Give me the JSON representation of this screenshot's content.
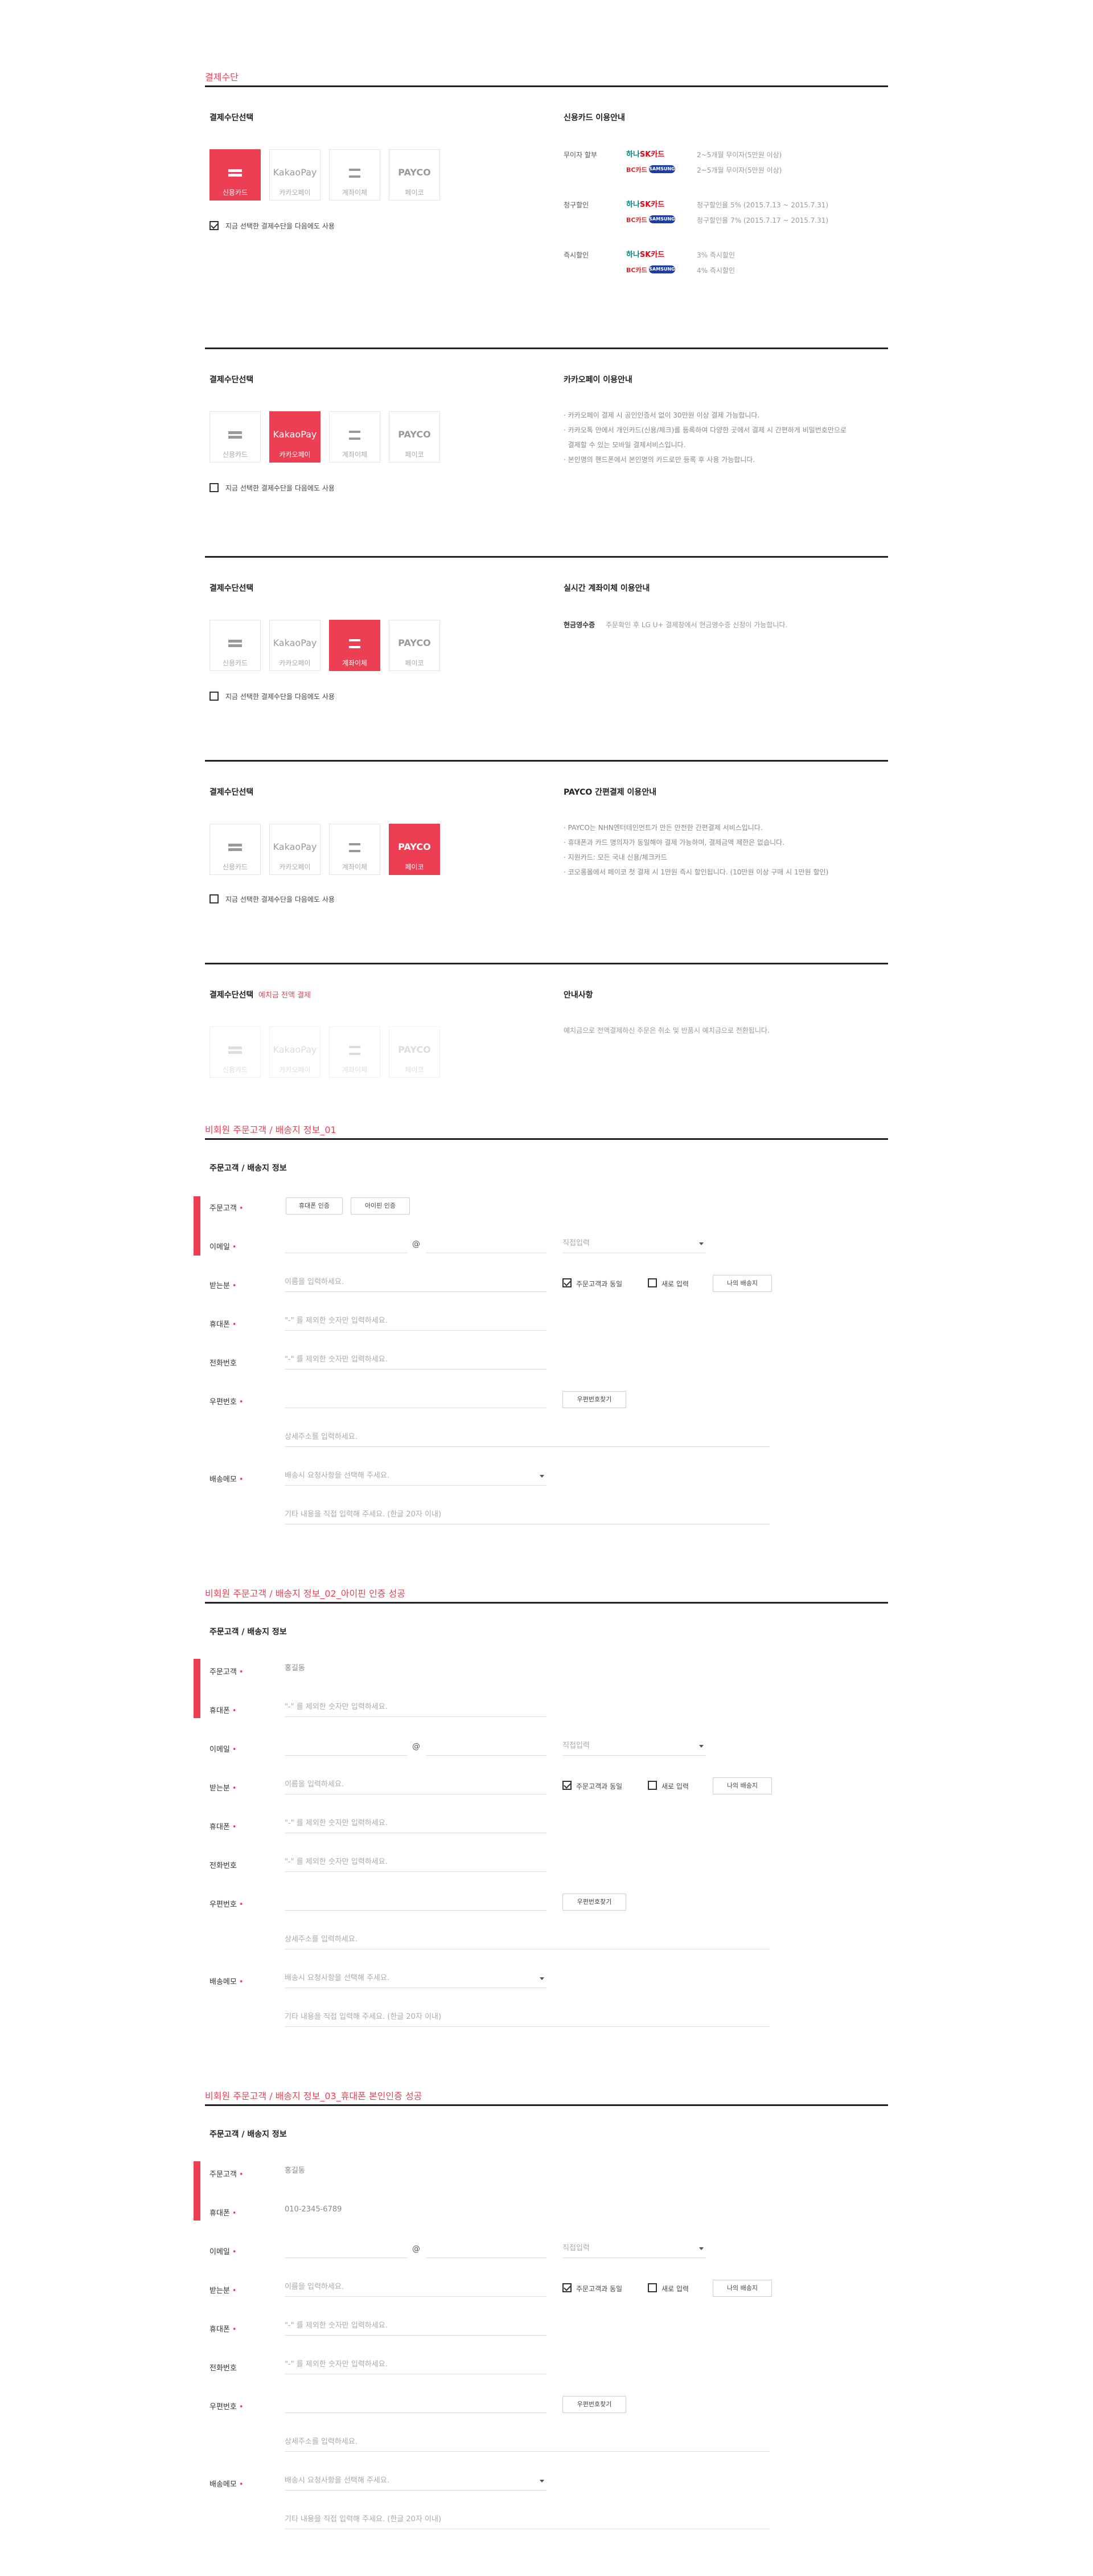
{
  "colors": {
    "accent": "#ec3f53",
    "text": "#333333"
  },
  "section1": {
    "title": "결제수단",
    "pay_title": "결제수단선택",
    "methods": [
      {
        "icon": "card-icon",
        "brand": "",
        "label": "신용카드"
      },
      {
        "icon": "kakaopay-icon",
        "brand": "KakaoPay",
        "label": "카카오페이"
      },
      {
        "icon": "bank-icon",
        "brand": "",
        "label": "계좌이체"
      },
      {
        "icon": "payco-icon",
        "brand": "PAYCO",
        "label": "페이코"
      }
    ],
    "remember": "지금 선택한 결제수단을 다음에도 사용",
    "info_title": "신용카드 이용안내",
    "rows": [
      {
        "label": "무이자 할부",
        "lines": [
          "2~5개월 무이자(5만원 이상)",
          "2~5개월 무이자(5만원 이상)"
        ]
      },
      {
        "label": "청구할인",
        "lines": [
          "청구할인율 5% (2015.7.13 ~ 2015.7.31)",
          "청구할인율 7% (2015.7.17 ~ 2015.7.31)"
        ]
      },
      {
        "label": "즉시할인",
        "lines": [
          "3% 즉시할인",
          "4% 즉시할인"
        ]
      }
    ],
    "logos": {
      "hana_a": "하나",
      "hana_b": "SK카드",
      "bc": "BC카드",
      "samsung": "SAMSUNG"
    }
  },
  "section2": {
    "pay_title": "결제수단선택",
    "info_title": "카카오페이 이용안내",
    "bullets": [
      "· 카카오페이 결제 시 공인인증서 없이 30만원 이상 결제 가능합니다.",
      "· 카카오톡 안에서 개인카드(신용/체크)를 등록하여 다양한 곳에서 결제 시 간편하게 비밀번호만으로",
      "  결제할 수 있는 모바일 결제서비스입니다.",
      "· 본인명의 핸드폰에서 본인명의 카드로만 등록 후 사용 가능합니다."
    ],
    "remember": "지금 선택한 결제수단을 다음에도 사용"
  },
  "section3": {
    "pay_title": "결제수단선택",
    "info_title": "실시간 계좌이체 이용안내",
    "receipt_label": "현금영수증",
    "receipt_text": "주문확인 후 LG U+ 결제창에서 현금영수증 신청이 가능합니다.",
    "remember": "지금 선택한 결제수단을 다음에도 사용"
  },
  "section4": {
    "pay_title": "결제수단선택",
    "info_title": "PAYCO 간편결제 이용안내",
    "bullets": [
      "· PAYCO는 NHN엔터테인먼트가 만든 안전한 간편결제 서비스입니다.",
      "· 휴대폰과 카드 명의자가 동일해야 결제 가능하며, 결제금액 제한은 없습니다.",
      "· 지원카드: 모든 국내 신용/체크카드",
      "· 코오롱몰에서 페이코 첫 결제 시 1만원 즉시 할인됩니다. (10만원 이상 구매 시 1만원 할인)"
    ],
    "remember": "지금 선택한 결제수단을 다음에도 사용"
  },
  "section5": {
    "pay_title": "결제수단선택",
    "pay_note": "예치금 전액 결제",
    "info_title": "안내사항",
    "info_text": "예치금으로 전액결제하신 주문은 취소 및 반품시 예치금으로 전환됩니다."
  },
  "forms": [
    {
      "title": "비회원 주문고객 / 배송지 정보_01"
    },
    {
      "title": "비회원 주문고객 / 배송지 정보_02_아이핀 인증 성공"
    },
    {
      "title": "비회원 주문고객 / 배송지 정보_03_휴대폰 본인인증 성공"
    }
  ],
  "form": {
    "sub_title": "주문고객 / 배송지 정보",
    "labels": {
      "orderer": "주문고객",
      "email": "이메일",
      "receiver": "받는분",
      "mobile": "휴대폰",
      "phone": "전화번호",
      "zip": "우편번호",
      "memo": "배송메모"
    },
    "required": "•",
    "phone_auth": "휴대폰 인증",
    "ipin_auth": "아이핀 인증",
    "email_domain": "직접입력",
    "at": "@",
    "receiver_ph": "이름을 입력하세요.",
    "same_as": "주문고객과 동일",
    "new_input": "새로 입력",
    "my_address": "나의 배송지",
    "num_ph": "\"-\" 를 제외한 숫자만 입력하세요.",
    "zip_btn": "우편번호찾기",
    "addr_ph": "상세주소를 입력하세요.",
    "memo_ph": "배송시 요청사항을 선택해 주세요.",
    "memo_etc_ph": "기타 내용을 직접 입력해 주세요. (한글 20자 이내)",
    "name_val": "홍길동",
    "mobile_val": "010-2345-6789"
  }
}
